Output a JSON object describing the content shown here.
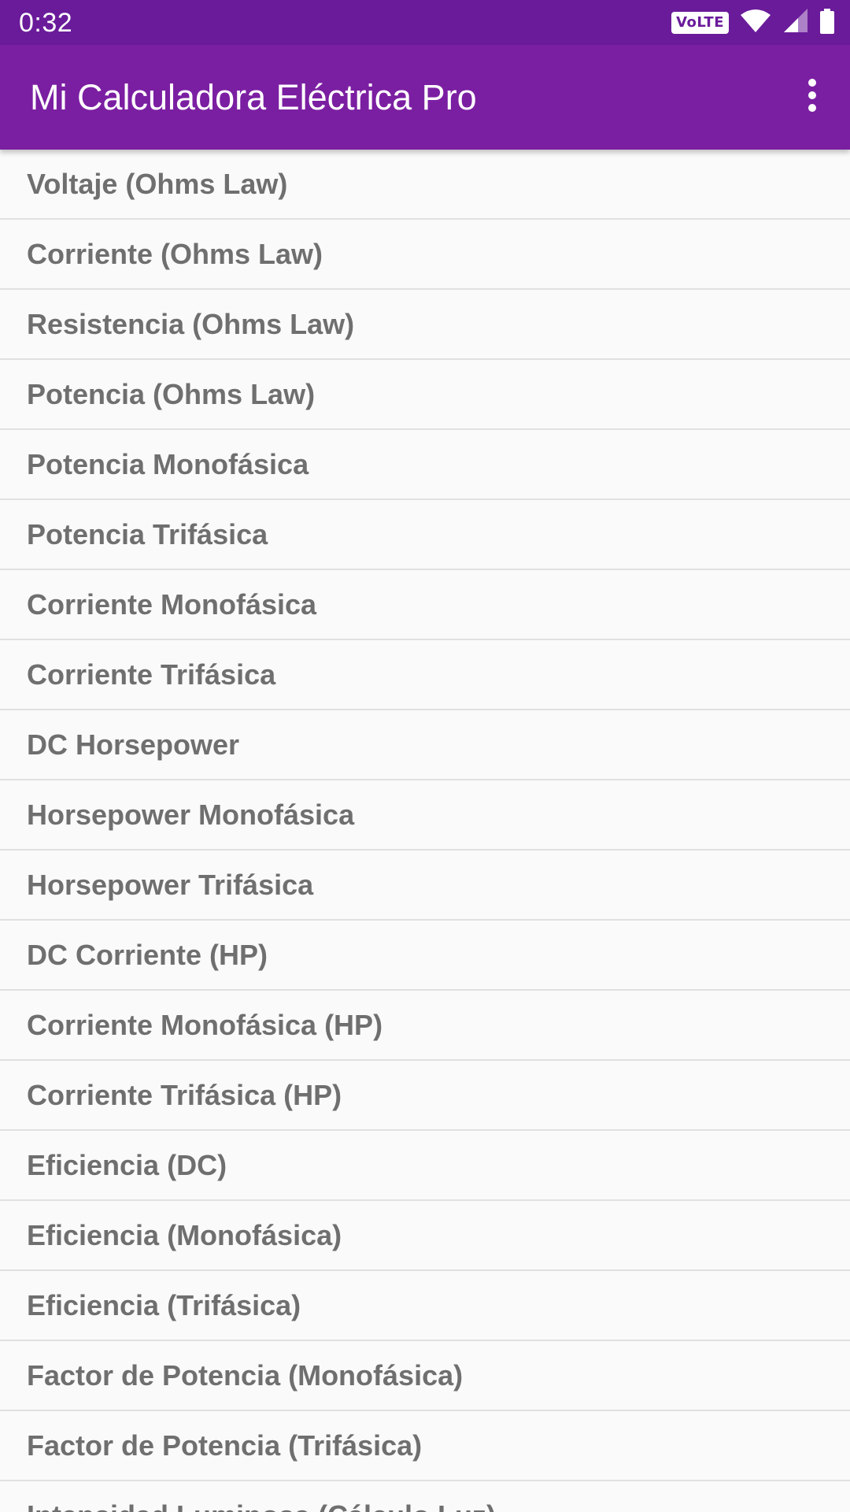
{
  "status_bar": {
    "time": "0:32",
    "volte": "VoLTE",
    "icons": [
      "wifi-icon",
      "cell-signal-icon",
      "battery-icon"
    ]
  },
  "app_bar": {
    "title": "Mi Calculadora Eléctrica Pro",
    "menu_icon": "more-vert-icon"
  },
  "colors": {
    "status_bar": "#6a1b9a",
    "app_bar": "#7b1fa2",
    "background": "#fafafa",
    "item_text": "#6f6f6f",
    "divider": "#e0e0e0"
  },
  "list": {
    "items": [
      "Voltaje (Ohms Law)",
      "Corriente (Ohms Law)",
      "Resistencia (Ohms Law)",
      "Potencia (Ohms Law)",
      "Potencia Monofásica",
      "Potencia Trifásica",
      "Corriente Monofásica",
      "Corriente Trifásica",
      "DC Horsepower",
      "Horsepower Monofásica",
      "Horsepower Trifásica",
      "DC Corriente (HP)",
      "Corriente Monofásica (HP)",
      "Corriente Trifásica (HP)",
      "Eficiencia (DC)",
      "Eficiencia (Monofásica)",
      "Eficiencia (Trifásica)",
      "Factor de Potencia (Monofásica)",
      "Factor de Potencia (Trifásica)",
      "Intensidad Luminosa (Cálculo Luz)"
    ]
  }
}
